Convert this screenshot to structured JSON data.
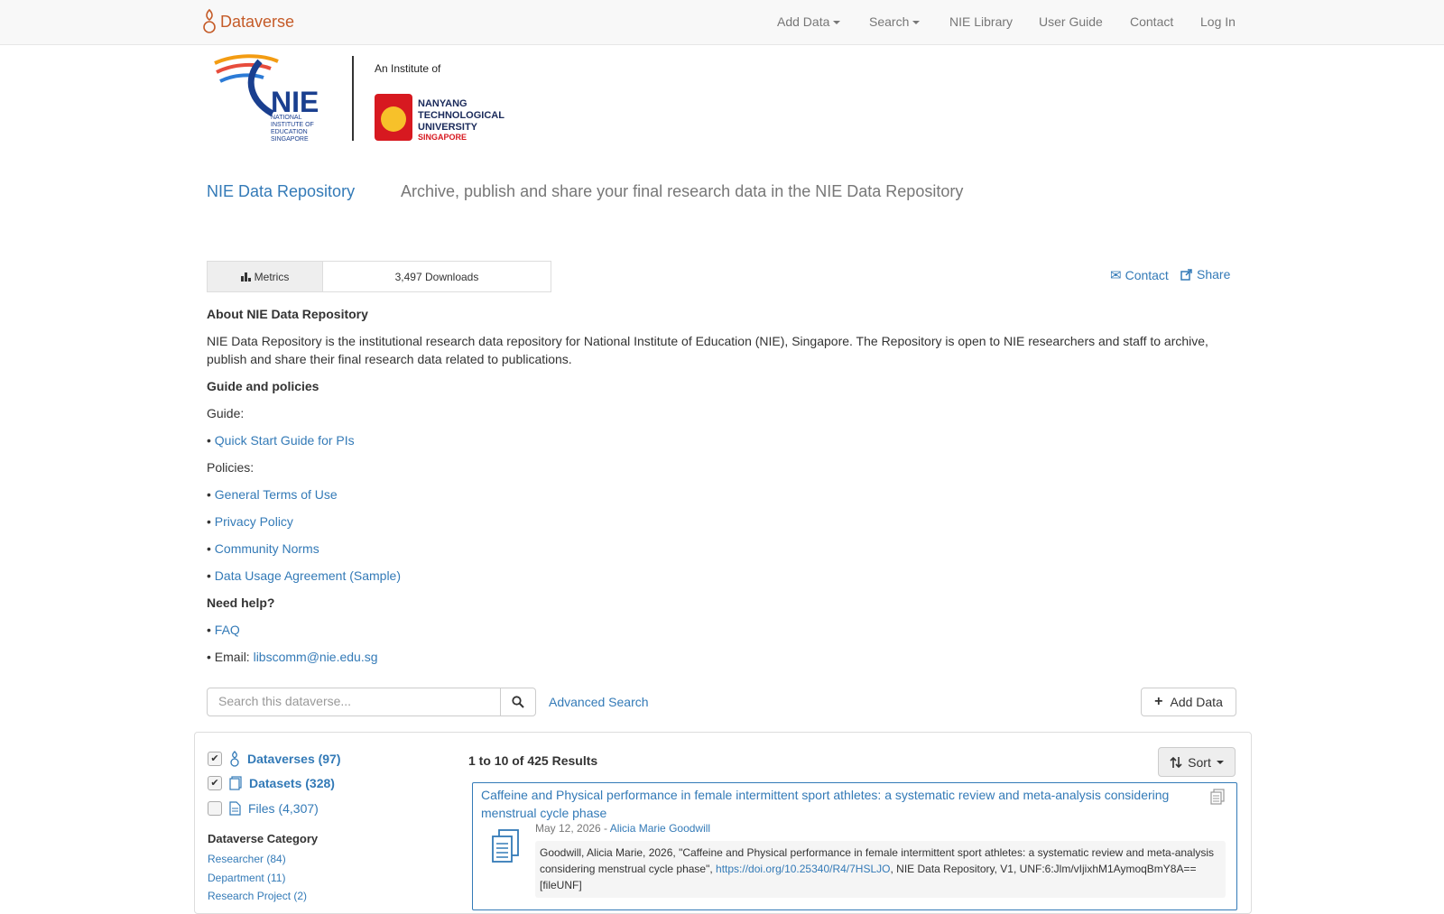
{
  "navbar": {
    "brand": "Dataverse",
    "items": [
      {
        "label": "Add Data",
        "dropdown": true
      },
      {
        "label": "Search",
        "dropdown": true
      },
      {
        "label": "NIE Library",
        "dropdown": false
      },
      {
        "label": "User Guide",
        "dropdown": false
      },
      {
        "label": "Contact",
        "dropdown": false
      },
      {
        "label": "Log In",
        "dropdown": false
      }
    ]
  },
  "logo": {
    "nie_lines": [
      "NATIONAL",
      "INSTITUTE OF",
      "EDUCATION",
      "SINGAPORE"
    ],
    "institute_of": "An Institute of",
    "ntu_lines": [
      "NANYANG",
      "TECHNOLOGICAL",
      "UNIVERSITY",
      "SINGAPORE"
    ]
  },
  "dataverse": {
    "name": "NIE Data Repository",
    "tagline": "Archive, publish and share your final research data in the NIE Data Repository"
  },
  "metrics": {
    "label": "Metrics",
    "value": "3,497 Downloads"
  },
  "actions": {
    "contact": "Contact",
    "share": "Share"
  },
  "description": {
    "about_heading": "About NIE Data Repository",
    "about_text": "NIE Data Repository is the institutional research data repository for National Institute of Education (NIE), Singapore. The Repository is open to NIE researchers and staff to archive, publish and share their final research data related to publications.",
    "guide_heading": "Guide and policies",
    "guide_label": "Guide:",
    "guide_links": [
      "Quick Start Guide for PIs"
    ],
    "policies_label": "Policies:",
    "policy_links": [
      "General Terms of Use",
      "Privacy Policy",
      "Community Norms",
      "Data Usage Agreement (Sample)"
    ],
    "help_heading": "Need help?",
    "help_links": [
      "FAQ"
    ],
    "email_label": "• Email: ",
    "email": "libscomm@nie.edu.sg",
    "bullet": "• "
  },
  "search": {
    "placeholder": "Search this dataverse...",
    "advanced": "Advanced Search",
    "add_data": "Add Data"
  },
  "facets": {
    "types": [
      {
        "label": "Dataverses (97)",
        "checked": true,
        "bold": true
      },
      {
        "label": "Datasets (328)",
        "checked": true,
        "bold": true
      },
      {
        "label": "Files (4,307)",
        "checked": false,
        "bold": false
      }
    ],
    "category_title": "Dataverse Category",
    "categories": [
      "Researcher (84)",
      "Department (11)",
      "Research Project (2)"
    ]
  },
  "results": {
    "count": "1 to 10 of 425 Results",
    "sort": "Sort",
    "items": [
      {
        "title": "Caffeine and Physical performance in female intermittent sport athletes: a systematic review and meta-analysis considering menstrual cycle phase",
        "date": "May 12, 2026 - ",
        "author": "Alicia Marie Goodwill",
        "citation_pre": "Goodwill, Alicia Marie, 2026, \"Caffeine and Physical performance in female intermittent sport athletes: a systematic review and meta-analysis considering menstrual cycle phase\", ",
        "doi": "https://doi.org/10.25340/R4/7HSLJO",
        "citation_post": ", NIE Data Repository, V1, UNF:6:Jlm/vIjixhM1AymoqBmY8A== [fileUNF]"
      }
    ]
  }
}
